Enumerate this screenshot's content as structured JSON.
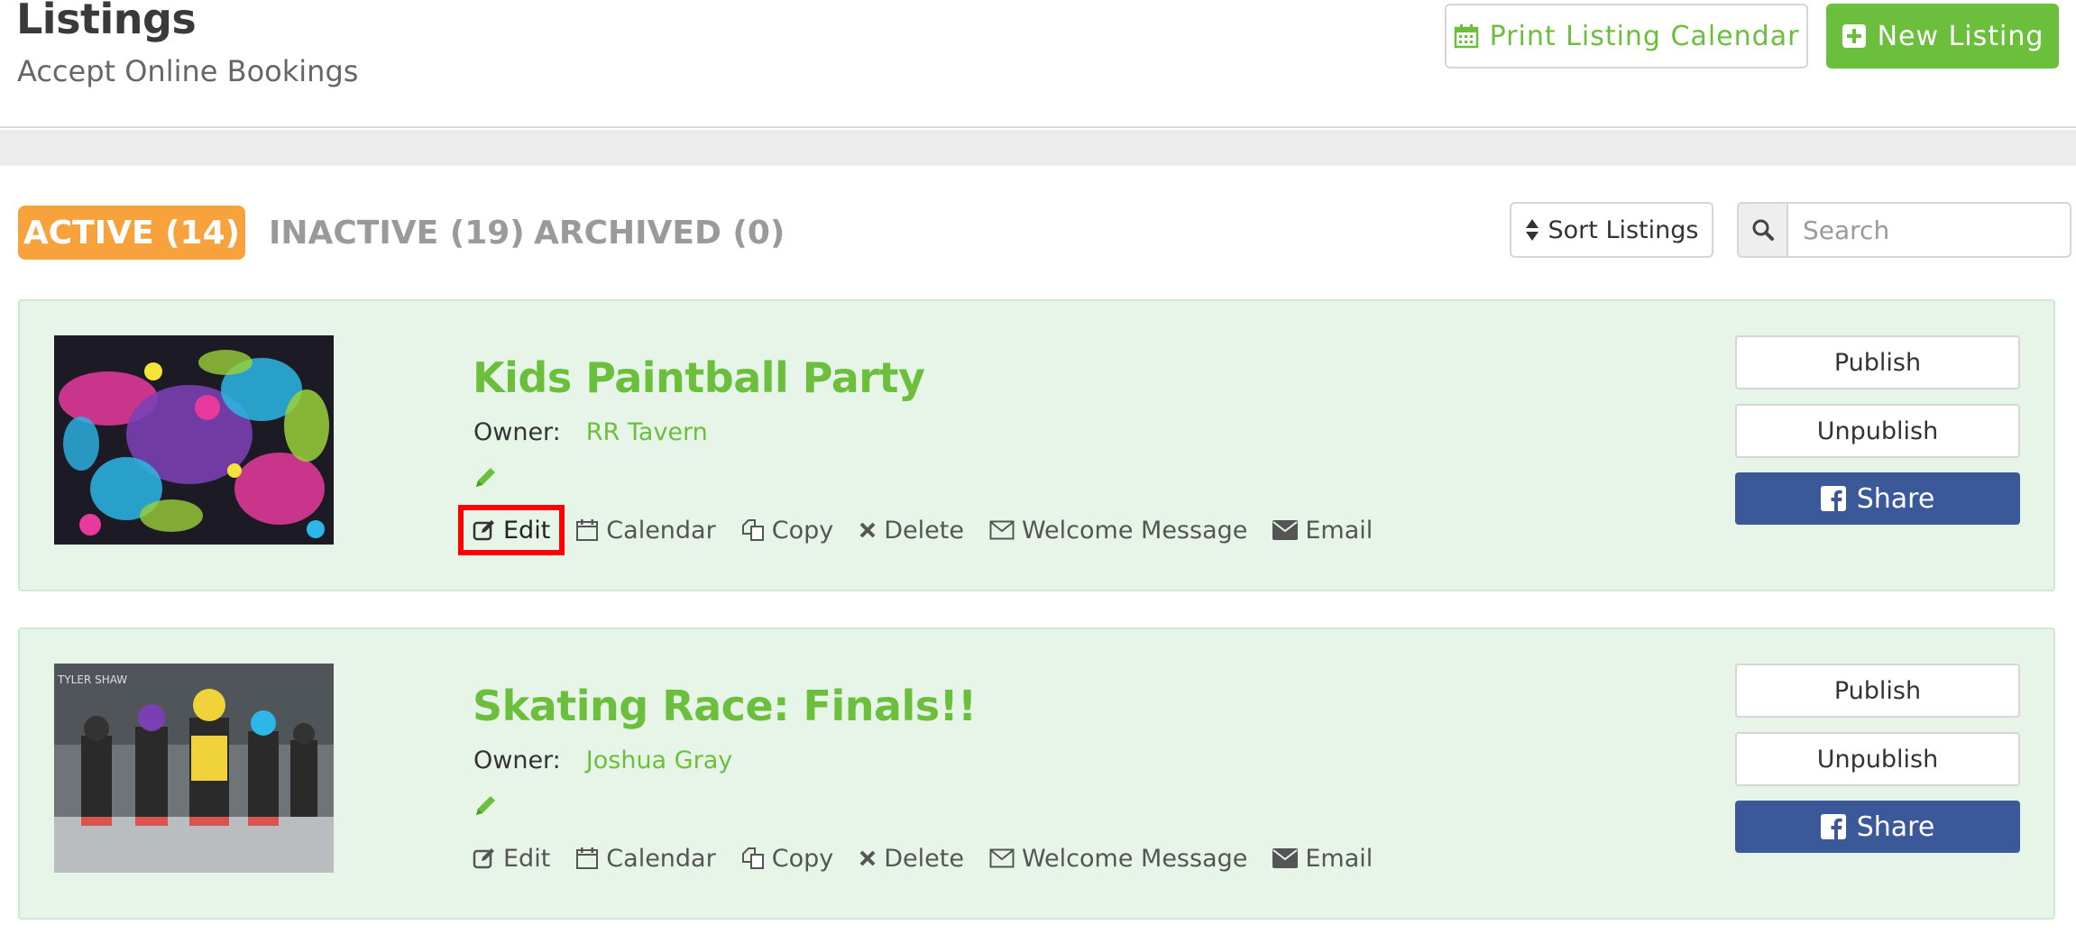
{
  "header": {
    "title": "Listings",
    "subtitle": "Accept Online Bookings",
    "print_calendar_label": "Print Listing Calendar",
    "new_listing_label": "New Listing"
  },
  "tabs": [
    {
      "label": "ACTIVE (14)",
      "active": true
    },
    {
      "label": "INACTIVE (19)",
      "active": false
    },
    {
      "label": "ARCHIVED (0)",
      "active": false
    }
  ],
  "toolbar": {
    "sort_label": "Sort Listings",
    "search_placeholder": "Search",
    "search_value": ""
  },
  "listings": [
    {
      "title": "Kids Paintball Party",
      "owner_label": "Owner:",
      "owner": "RR Tavern",
      "image_icon": "paint-splatter-image",
      "actions": [
        "Edit",
        "Calendar",
        "Copy",
        "Delete",
        "Welcome Message",
        "Email"
      ],
      "publish_label": "Publish",
      "unpublish_label": "Unpublish",
      "share_label": "Share"
    },
    {
      "title": "Skating Race: Finals!!",
      "owner_label": "Owner:",
      "owner": "Joshua Gray",
      "image_icon": "roller-derby-photo",
      "actions": [
        "Edit",
        "Calendar",
        "Copy",
        "Delete",
        "Welcome Message",
        "Email"
      ],
      "publish_label": "Publish",
      "unpublish_label": "Unpublish",
      "share_label": "Share"
    }
  ],
  "colors": {
    "accent_green": "#6cbf3c",
    "active_tab": "#f7a23c",
    "card_bg": "#e6f5e8",
    "facebook_blue": "#3b5998",
    "highlight": "#ff0000"
  }
}
